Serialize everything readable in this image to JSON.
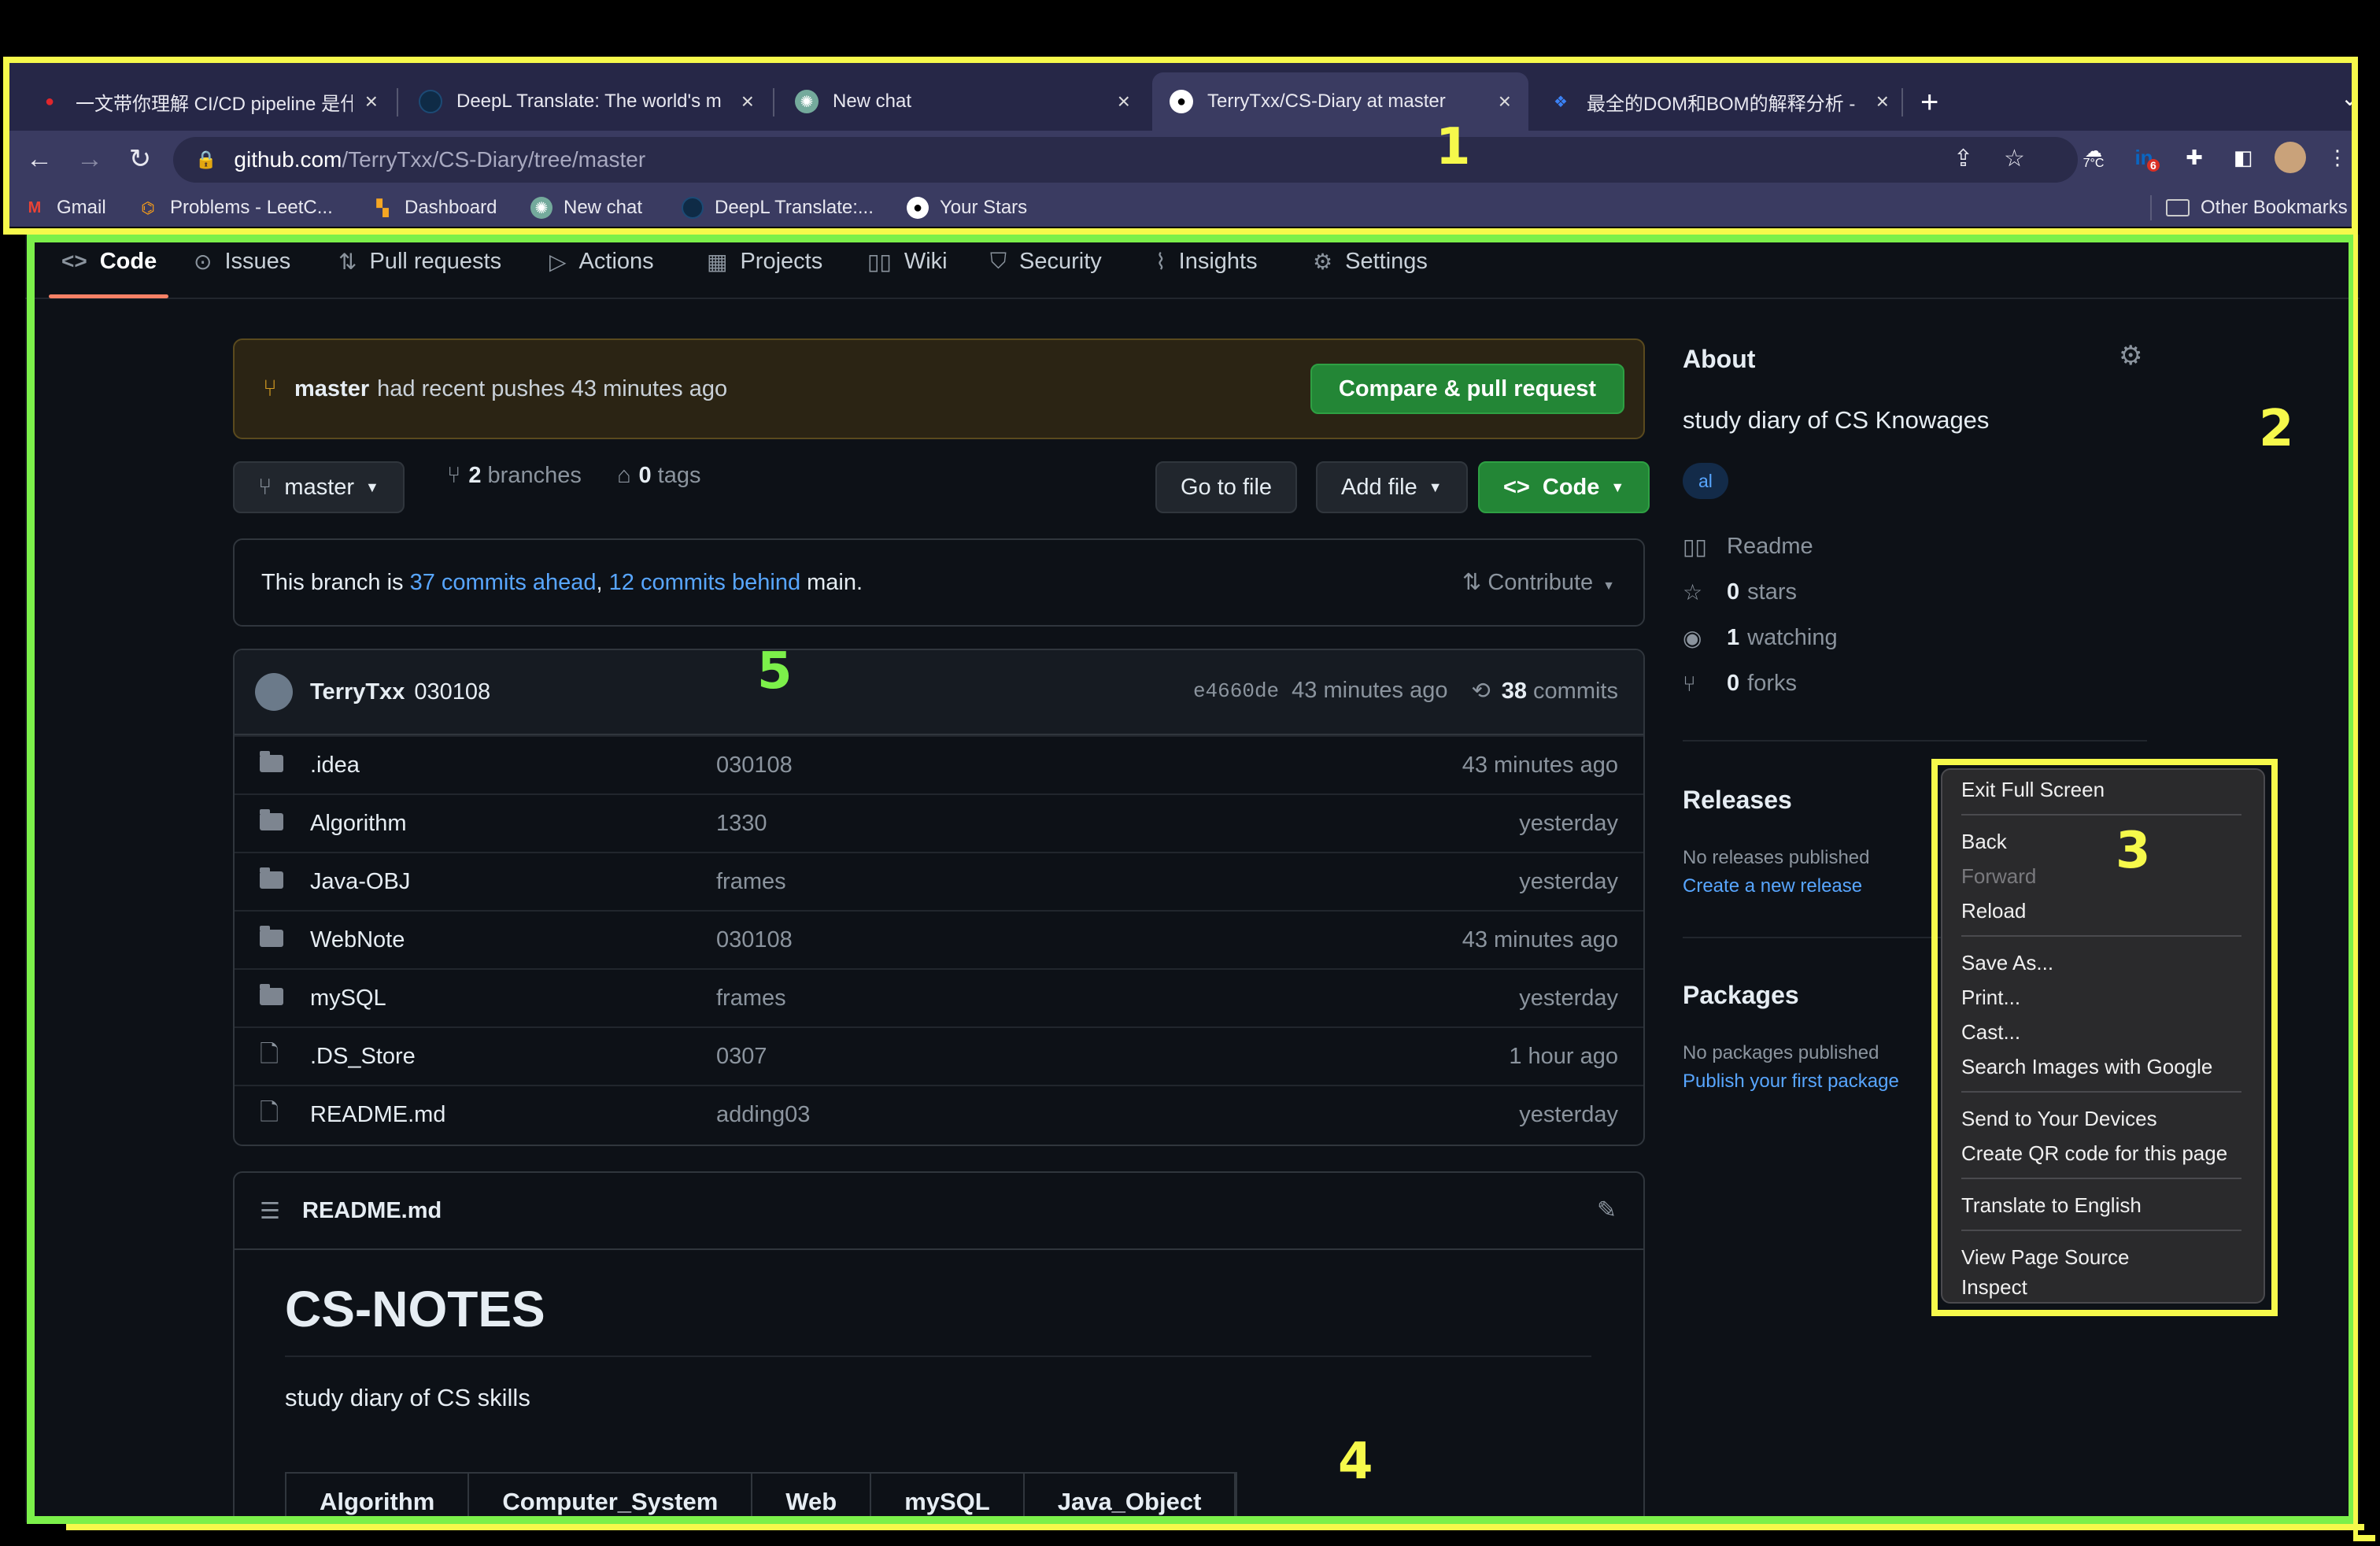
{
  "browser": {
    "tabs": [
      {
        "title": "一文带你理解 CI/CD pipeline 是什",
        "icon": "redhat-icon",
        "active": false
      },
      {
        "title": "DeepL Translate: The world's m",
        "icon": "deepl-icon",
        "active": false
      },
      {
        "title": "New chat",
        "icon": "chatgpt-icon",
        "active": false
      },
      {
        "title": "TerryTxx/CS-Diary at master",
        "icon": "github-icon",
        "active": true
      },
      {
        "title": "最全的DOM和BOM的解释分析 -",
        "icon": "blog-icon",
        "active": false
      }
    ],
    "url_host": "github.com",
    "url_path": "/TerryTxx/CS-Diary/tree/master",
    "weather": "7°C",
    "ext_badge": "6",
    "bookmarks": [
      "Gmail",
      "Problems - LeetC...",
      "Dashboard",
      "New chat",
      "DeepL Translate:...",
      "Your Stars"
    ],
    "other_bookmarks": "Other Bookmarks"
  },
  "repo_nav": [
    "Code",
    "Issues",
    "Pull requests",
    "Actions",
    "Projects",
    "Wiki",
    "Security",
    "Insights",
    "Settings"
  ],
  "push_banner": {
    "branch": "master",
    "text": "had recent pushes 43 minutes ago",
    "button": "Compare & pull request"
  },
  "toolbar": {
    "branch": "master",
    "branches_count": "2",
    "branches_label": "branches",
    "tags_count": "0",
    "tags_label": "tags",
    "go_to_file": "Go to file",
    "add_file": "Add file",
    "code": "Code"
  },
  "branch_info": {
    "prefix": "This branch is",
    "ahead": "37 commits ahead",
    "comma": ",",
    "behind": "12 commits behind",
    "suffix": "main.",
    "contribute": "Contribute"
  },
  "latest_commit": {
    "author": "TerryTxx",
    "message": "030108",
    "sha": "e4660de",
    "age": "43 minutes ago",
    "count": "38",
    "count_label": "commits"
  },
  "files": [
    {
      "name": ".idea",
      "type": "dir",
      "message": "030108",
      "age": "43 minutes ago"
    },
    {
      "name": "Algorithm",
      "type": "dir",
      "message": "1330",
      "age": "yesterday"
    },
    {
      "name": "Java-OBJ",
      "type": "dir",
      "message": "frames",
      "age": "yesterday"
    },
    {
      "name": "WebNote",
      "type": "dir",
      "message": "030108",
      "age": "43 minutes ago"
    },
    {
      "name": "mySQL",
      "type": "dir",
      "message": "frames",
      "age": "yesterday"
    },
    {
      "name": ".DS_Store",
      "type": "file",
      "message": "0307",
      "age": "1 hour ago"
    },
    {
      "name": "README.md",
      "type": "file",
      "message": "adding03",
      "age": "yesterday"
    }
  ],
  "readme": {
    "filename": "README.md",
    "title": "CS-NOTES",
    "description": "study diary of CS skills",
    "table_headers": [
      "Algorithm",
      "Computer_System",
      "Web",
      "mySQL",
      "Java_Object"
    ]
  },
  "about": {
    "title": "About",
    "description": "study diary of CS Knowages",
    "topic": "al",
    "readme": "Readme",
    "stars_count": "0",
    "stars_label": "stars",
    "watching_count": "1",
    "watching_label": "watching",
    "forks_count": "0",
    "forks_label": "forks",
    "releases_title": "Releases",
    "releases_none": "No releases published",
    "releases_link": "Create a new release",
    "packages_title": "Packages",
    "packages_none": "No packages published",
    "packages_link": "Publish your first package"
  },
  "context_menu": {
    "items": [
      "Exit Full Screen",
      "Back",
      "Forward",
      "Reload",
      "Save As...",
      "Print...",
      "Cast...",
      "Search Images with Google",
      "Send to Your Devices",
      "Create QR code for this page",
      "Translate to English",
      "View Page Source",
      "Inspect"
    ]
  },
  "annotations": [
    "1",
    "2",
    "3",
    "4",
    "5"
  ],
  "colors": {
    "annotation_yellow": "#f6f94b",
    "annotation_green": "#7cf04a",
    "github_bg": "#0d1117",
    "accent_green": "#238636",
    "link_blue": "#58a6ff"
  }
}
